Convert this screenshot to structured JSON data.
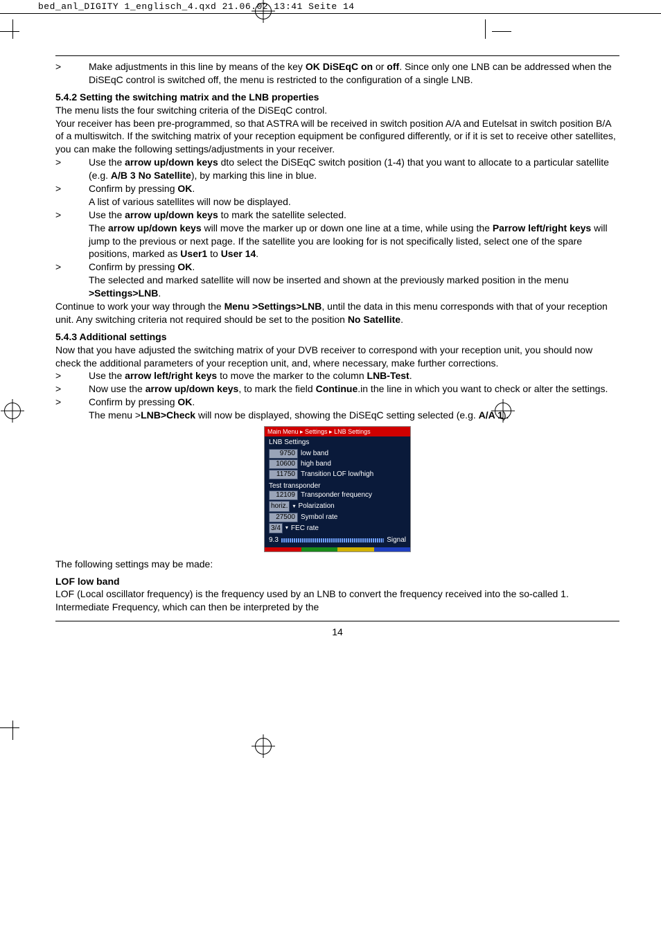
{
  "header_line": "bed_anl_DIGITY 1_englisch_4.qxd  21.06.02  13:41  Seite 14",
  "page_number": "14",
  "lnb": {
    "breadcrumb": "Main Menu ▸ Settings ▸ LNB Settings",
    "section1": "LNB Settings",
    "r1v": "9750",
    "r1l": "low band",
    "r2v": "10600",
    "r2l": "high band",
    "r3v": "11750",
    "r3l": "Transition LOF low/high",
    "section2": "Test transponder",
    "r4v": "12109",
    "r4l": "Transponder frequency",
    "r5v": "horiz.",
    "r5l": "Polarization",
    "r6v": "27500",
    "r6l": "Symbol rate",
    "r7v": "3/4",
    "r7l": "FEC rate",
    "sigv": "9.3",
    "sigl": "Signal"
  },
  "t": {
    "b1a": "Make adjustments in this line by means of the key ",
    "b1b": "OK DiSEqC on",
    "b1c": " or ",
    "b1d": "off",
    "b1e": ". Since only one LNB can be addressed when the DiSEqC control is switched off, the menu is restricted to the configuration of a single LNB.",
    "h542": "5.4.2 Setting the switching matrix and the LNB properties",
    "p1": "The menu lists the four switching criteria of the DiSEqC control.",
    "p2": "Your receiver has been pre-programmed, so that ASTRA will be received in switch position A/A and Eutelsat in switch position B/A of a multiswitch. If the switching matrix of your reception equipment be configured differently, or if it is set to receive other satellites, you can make the following settings/adjustments in your receiver.",
    "b2a": "Use the ",
    "b2b": "arrow up/down keys",
    "b2c": " dto select the DiSEqC switch position (1-4) that you want to allocate to a particular satellite (e.g. ",
    "b2d": "A/B 3 No Satellite",
    "b2e": "), by marking this line in blue.",
    "b3a": "Confirm by pressing ",
    "b3b": "OK",
    "b3c": ".",
    "b3d": "A list of various satellites will now be displayed.",
    "b4a": "Use the ",
    "b4b": "arrow up/down keys",
    "b4c": " to mark the satellite selected.",
    "b4d": "The ",
    "b4e": "arrow up/down keys",
    "b4f": " will move the marker up or down one line at a time, while using the ",
    "b4g": "Parrow left/right keys",
    "b4h": "  will jump to the previous or next page. If the satellite you are looking for is not specifically listed, select one of the spare positions, marked as ",
    "b4i": "User1",
    "b4j": " to ",
    "b4k": "User 14",
    "b4l": ".",
    "b5a": "Confirm by pressing ",
    "b5b": "OK",
    "b5c": ".",
    "b5d": "The selected and marked satellite will now be inserted and shown at the previously marked position in the menu ",
    "b5e": ">Settings>LNB",
    "b5f": ".",
    "p3a": "Continue to work your way through the ",
    "p3b": "Menu >Settings>LNB",
    "p3c": ", until the data in this menu corresponds with that of your reception unit. Any switching criteria not required should be set to the position ",
    "p3d": "No Satellite",
    "p3e": ".",
    "h543": "5.4.3 Additional settings",
    "p4": "Now that you have adjusted the switching matrix of your DVB receiver to correspond with your reception unit, you should now check the additional parameters of your reception unit, and, where necessary, make further corrections.",
    "b6a": "Use the ",
    "b6b": "arrow left/right keys",
    "b6c": " to move the marker to the column ",
    "b6d": "LNB-Test",
    "b6e": ".",
    "b7a": "Now use the ",
    "b7b": "arrow up/down keys",
    "b7c": ", to mark the field ",
    "b7d": "Continue",
    "b7e": ".in the line in which you want to check or alter the settings.",
    "b8a": "Confirm by pressing ",
    "b8b": "OK",
    "b8c": ".",
    "b8d": "The menu >",
    "b8e": "LNB>Check",
    "b8f": " will now be displayed, showing the DiSEqC setting selected (e.g. ",
    "b8g": "A/A 1",
    "b8h": ").",
    "p5": "The following settings may be made:",
    "hlof": "LOF low band",
    "p6": "LOF (Local oscillator frequency) is the frequency used by an LNB to convert the frequency received into the so-called 1. Intermediate Frequency, which can then be interpreted by the"
  }
}
